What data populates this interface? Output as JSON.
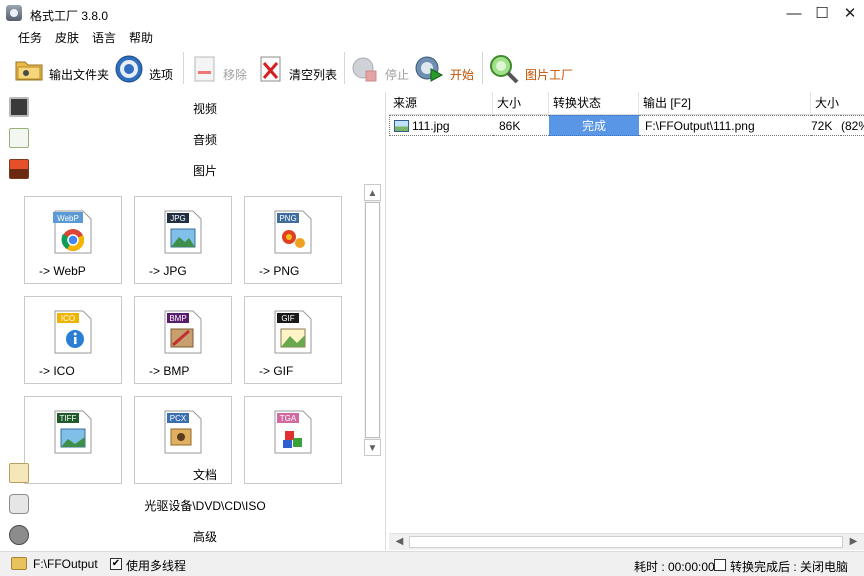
{
  "window": {
    "title": "格式工厂 3.8.0",
    "minimize_glyph": "—",
    "maximize_glyph": "☐",
    "close_glyph": "✕"
  },
  "menu": [
    {
      "label": "任务"
    },
    {
      "label": "皮肤"
    },
    {
      "label": "语言"
    },
    {
      "label": "帮助"
    }
  ],
  "toolbar": {
    "output_folder": "输出文件夹",
    "options": "选项",
    "remove": "移除",
    "clear_list": "清空列表",
    "stop": "停止",
    "start": "开始",
    "picture_factory": "图片工厂"
  },
  "categories": {
    "video": "视频",
    "audio": "音频",
    "picture": "图片",
    "document": "文档",
    "optical": "光驱设备\\DVD\\CD\\ISO",
    "advanced": "高级"
  },
  "formats": [
    {
      "label": "-> WebP",
      "badge": "WebP",
      "badge_color": "#5b9bd5"
    },
    {
      "label": "-> JPG",
      "badge": "JPG",
      "badge_color": "#203040"
    },
    {
      "label": "-> PNG",
      "badge": "PNG",
      "badge_color": "#3f6e9e"
    },
    {
      "label": "-> ICO",
      "badge": "ICO",
      "badge_color": "#f0b400"
    },
    {
      "label": "-> BMP",
      "badge": "BMP",
      "badge_color": "#5a1d6e"
    },
    {
      "label": "-> GIF",
      "badge": "GIF",
      "badge_color": "#1a1a1a"
    },
    {
      "label": "",
      "badge": "TIFF",
      "badge_color": "#1e5a2a"
    },
    {
      "label": "",
      "badge": "PCX",
      "badge_color": "#3a6fb0"
    },
    {
      "label": "",
      "badge": "TGA",
      "badge_color": "#d06aa0"
    }
  ],
  "table": {
    "columns": [
      "来源",
      "大小",
      "转换状态",
      "输出 [F2]",
      "大小"
    ],
    "rows": [
      {
        "source": "111.jpg",
        "size": "86K",
        "status": "完成",
        "output": "F:\\FFOutput\\111.png",
        "out_size": "72K",
        "extra": "(82%)"
      }
    ]
  },
  "statusbar": {
    "output_path": "F:\\FFOutput",
    "multithread_label": "使用多线程",
    "multithread_checked": true,
    "elapsed_label": "耗时 : 00:00:00",
    "after_label": "转换完成后 : 关闭电脑",
    "after_checked": false
  },
  "colors": {
    "status_done": "#5a96e6",
    "start_label": "#c05000",
    "picture_factory_label": "#c05000"
  }
}
